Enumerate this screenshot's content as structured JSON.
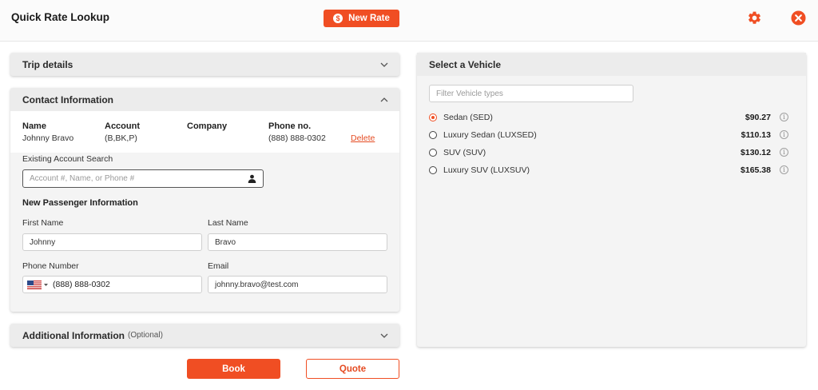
{
  "header": {
    "title": "Quick Rate Lookup",
    "new_rate_label": "New Rate",
    "new_rate_icon": "dollar-circle-icon",
    "settings_icon": "gear-icon",
    "close_icon": "close-circle-icon",
    "accent_color": "#f04e23"
  },
  "trip_details": {
    "title": "Trip details"
  },
  "contact": {
    "title": "Contact Information",
    "summary": {
      "name_label": "Name",
      "name_value": "Johnny Bravo",
      "account_label": "Account",
      "account_value": "(B,BK,P)",
      "company_label": "Company",
      "company_value": "",
      "phone_label": "Phone no.",
      "phone_value": "(888) 888-0302",
      "delete_label": "Delete"
    },
    "account_search": {
      "label": "Existing Account Search",
      "placeholder": "Account #, Name, or Phone #"
    },
    "new_passenger": {
      "title": "New Passenger Information",
      "first_name_label": "First Name",
      "first_name_value": "Johnny",
      "last_name_label": "Last Name",
      "last_name_value": "Bravo",
      "phone_label": "Phone Number",
      "phone_value": "(888) 888-0302",
      "phone_country_icon": "us-flag-icon",
      "email_label": "Email",
      "email_value": "johnny.bravo@test.com"
    }
  },
  "additional": {
    "title": "Additional Information",
    "optional_label": "(Optional)"
  },
  "actions": {
    "book_label": "Book",
    "quote_label": "Quote"
  },
  "vehicles": {
    "title": "Select a Vehicle",
    "filter_placeholder": "Filter Vehicle types",
    "items": [
      {
        "name": "Sedan (SED)",
        "price": "$90.27",
        "selected": true
      },
      {
        "name": "Luxury Sedan (LUXSED)",
        "price": "$110.13",
        "selected": false
      },
      {
        "name": "SUV (SUV)",
        "price": "$130.12",
        "selected": false
      },
      {
        "name": "Luxury SUV (LUXSUV)",
        "price": "$165.38",
        "selected": false
      }
    ]
  }
}
